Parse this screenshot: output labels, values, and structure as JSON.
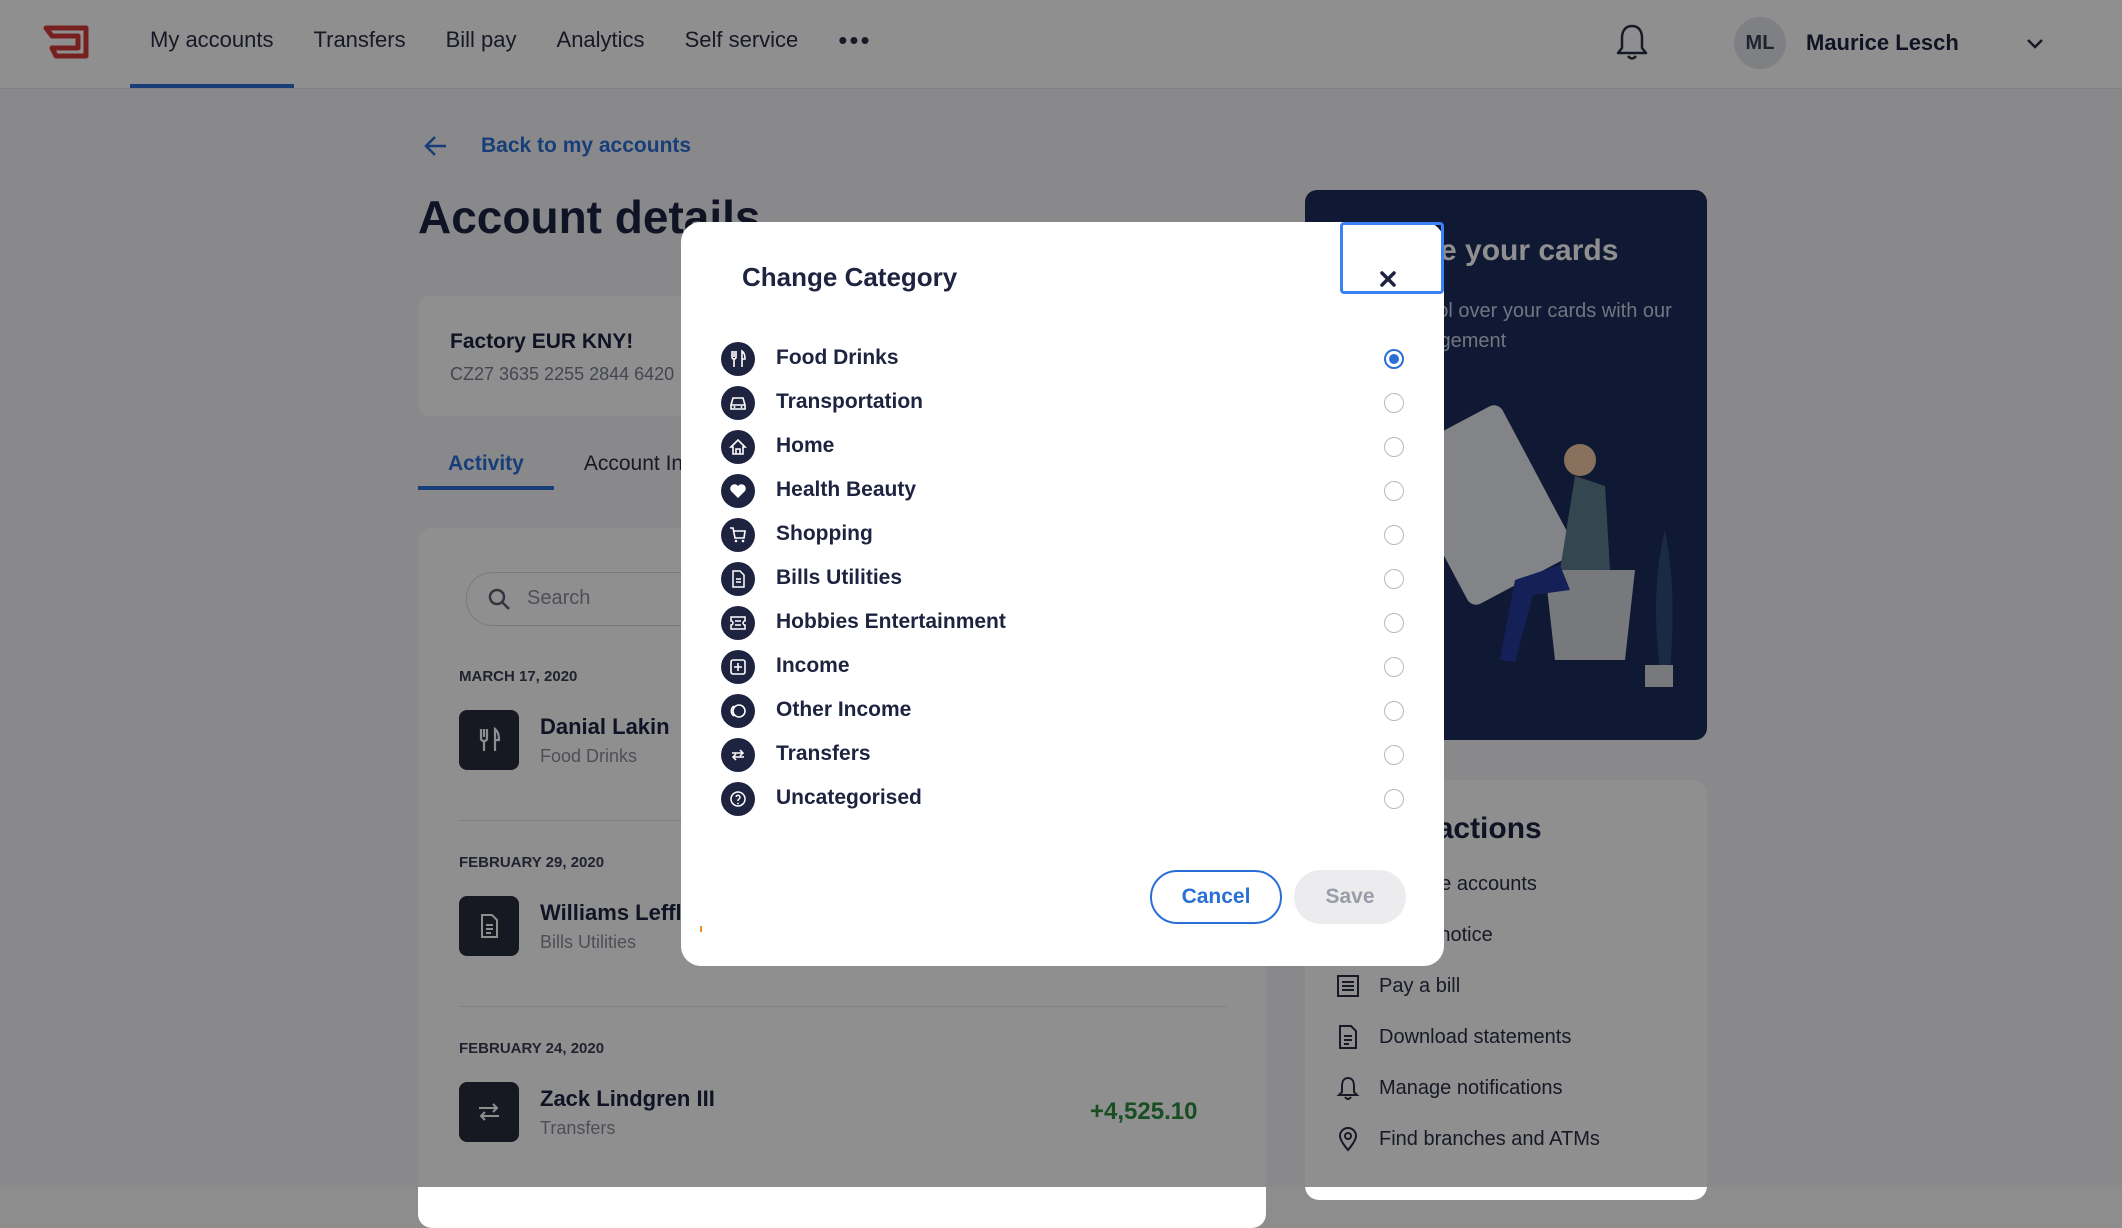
{
  "topnav": {
    "items": [
      {
        "label": "My accounts",
        "active": true
      },
      {
        "label": "Transfers"
      },
      {
        "label": "Bill pay"
      },
      {
        "label": "Analytics"
      },
      {
        "label": "Self service"
      }
    ],
    "more_label": "•••",
    "user": {
      "initials": "ML",
      "name": "Maurice Lesch"
    },
    "icons": [
      "logo",
      "bell-icon",
      "chevron-down-icon",
      "more-icon"
    ]
  },
  "page": {
    "back_label": "Back to my accounts",
    "title": "Account details",
    "account": {
      "name": "Factory EUR KNY!",
      "iban": "CZ27 3635 2255 2844 6420"
    },
    "tabs": [
      {
        "label": "Activity",
        "active": true
      },
      {
        "label": "Account Info"
      }
    ],
    "search_placeholder": "Search",
    "transactions": [
      {
        "date": "MARCH 17, 2020",
        "name": "Danial Lakin",
        "category": "Food Drinks",
        "amount": "",
        "icon": "food-drinks-icon"
      },
      {
        "date": "FEBRUARY 29, 2020",
        "name": "Williams Leffler",
        "category": "Bills Utilities",
        "amount": "",
        "icon": "bills-utilities-icon"
      },
      {
        "date": "FEBRUARY 24, 2020",
        "name": "Zack Lindgren III",
        "category": "Transfers",
        "amount": "+4,525.10",
        "icon": "transfers-icon"
      }
    ],
    "promo": {
      "title": "Manage your cards",
      "text": "Take control over your cards with our card management"
    },
    "quick_actions": {
      "title": "Quick actions",
      "items": [
        {
          "label": "Manage accounts",
          "icon": "accounts-icon"
        },
        {
          "label": "Travel notice",
          "icon": "travel-icon"
        },
        {
          "label": "Pay a bill",
          "icon": "bill-icon"
        },
        {
          "label": "Download statements",
          "icon": "statement-icon"
        },
        {
          "label": "Manage notifications",
          "icon": "notification-icon"
        },
        {
          "label": "Find branches and ATMs",
          "icon": "location-pin-icon"
        }
      ]
    }
  },
  "modal": {
    "title": "Change Category",
    "close_label": "×",
    "categories": [
      {
        "label": "Food Drinks",
        "icon": "food-drinks-icon",
        "selected": true
      },
      {
        "label": "Transportation",
        "icon": "car-icon",
        "selected": false
      },
      {
        "label": "Home",
        "icon": "home-icon",
        "selected": false
      },
      {
        "label": "Health Beauty",
        "icon": "heart-icon",
        "selected": false
      },
      {
        "label": "Shopping",
        "icon": "cart-icon",
        "selected": false
      },
      {
        "label": "Bills Utilities",
        "icon": "document-icon",
        "selected": false
      },
      {
        "label": "Hobbies Entertainment",
        "icon": "ticket-icon",
        "selected": false
      },
      {
        "label": "Income",
        "icon": "plus-box-icon",
        "selected": false
      },
      {
        "label": "Other Income",
        "icon": "coins-icon",
        "selected": false
      },
      {
        "label": "Transfers",
        "icon": "transfer-arrows-icon",
        "selected": false
      },
      {
        "label": "Uncategorised",
        "icon": "question-icon",
        "selected": false
      }
    ],
    "cancel_label": "Cancel",
    "save_label": "Save",
    "save_disabled": true
  },
  "colors": {
    "accent": "#2a6fd6",
    "navy": "#1e2340",
    "promo": "#1d2d5c",
    "positive": "#2e8b3e",
    "brand": "#d23a3a"
  }
}
